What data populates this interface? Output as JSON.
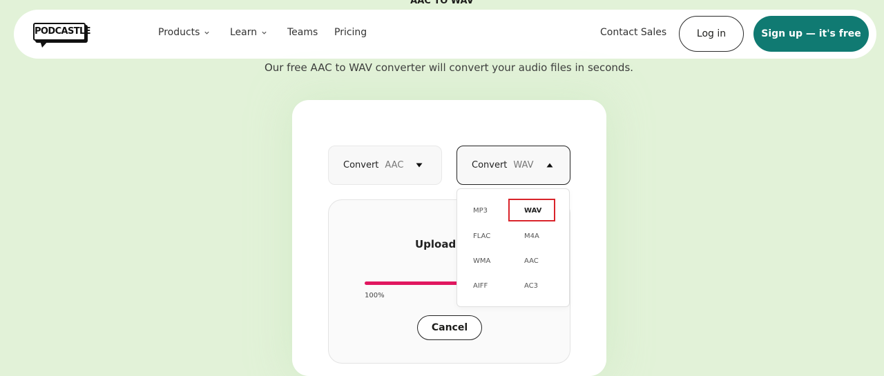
{
  "page": {
    "top_title": "AAC TO WAV",
    "subtitle": "Our free AAC to WAV converter will convert your audio files in seconds."
  },
  "navbar": {
    "logo_text": "PODCASTLE",
    "items": [
      {
        "label": "Products",
        "has_dropdown": true
      },
      {
        "label": "Learn",
        "has_dropdown": true
      },
      {
        "label": "Teams",
        "has_dropdown": false
      },
      {
        "label": "Pricing",
        "has_dropdown": false
      }
    ],
    "contact_sales": "Contact Sales",
    "login": "Log in",
    "signup": "Sign up — it's free"
  },
  "converter": {
    "from": {
      "label": "Convert",
      "value": "AAC",
      "arrow": "down"
    },
    "to": {
      "label": "Convert",
      "value": "WAV",
      "arrow": "up"
    },
    "status_text": "Uploadi",
    "progress_percent": 100,
    "progress_label": "100%",
    "cancel_label": "Cancel"
  },
  "dropdown": {
    "options": [
      "MP3",
      "WAV",
      "FLAC",
      "M4A",
      "WMA",
      "AAC",
      "AIFF",
      "AC3"
    ],
    "selected": "WAV"
  },
  "colors": {
    "background": "#e2f2d8",
    "signup_bg": "#107a72",
    "progress_fill": "#e0175f",
    "highlight": "#d9232a"
  }
}
